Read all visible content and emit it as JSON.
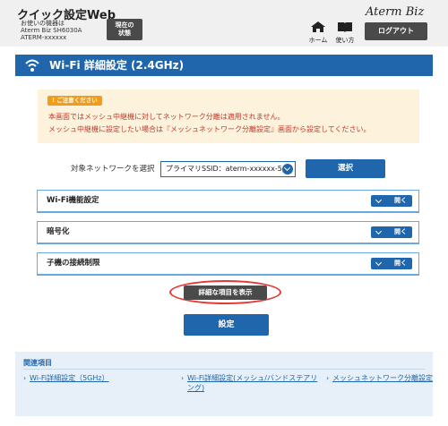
{
  "header": {
    "app_title": "クイック設定Web",
    "device_lines": [
      "お使いの機器は",
      "Aterm Biz SH6030A",
      "ATERM-xxxxxx"
    ],
    "status_button": [
      "現在の",
      "状態"
    ],
    "brand": "Aterm Biz",
    "home_label": "ホーム",
    "manual_label": "使い方",
    "logout_label": "ログアウト"
  },
  "page": {
    "title": "Wi-Fi 詳細設定 (2.4GHz)"
  },
  "notice": {
    "badge": "ご注意ください",
    "lines": [
      "本画面ではメッシュ中継機に対してネットワーク分離は適用されません。",
      "メッシュ中継機に設定したい場合は『メッシュネットワーク分離設定』画面から設定してください。"
    ]
  },
  "network_select": {
    "label": "対象ネットワークを選択",
    "value": "プライマリSSID：aterm-xxxxxx-5p",
    "button": "選択"
  },
  "sections": [
    {
      "label": "Wi-Fi機能設定",
      "button": "開く"
    },
    {
      "label": "暗号化",
      "button": "開く"
    },
    {
      "label": "子機の接続制限",
      "button": "開く"
    }
  ],
  "detail_button": "詳細な項目を表示",
  "save_button": "設定",
  "related": {
    "heading": "関連項目",
    "links": [
      "Wi-Fi詳細設定（5GHz）",
      "Wi-Fi詳細設定(メッシュ/バンドステアリング)",
      "メッシュネットワーク分離設定"
    ]
  },
  "colors": {
    "primary": "#1f66ad",
    "header_bg": "#f0f0f0",
    "dark_button": "#4a4a4a",
    "notice_bg": "#fdf3dd",
    "notice_text": "#c0392b",
    "badge": "#f29c1b",
    "highlight": "#e53935",
    "related_bg": "#e7f0f8"
  }
}
